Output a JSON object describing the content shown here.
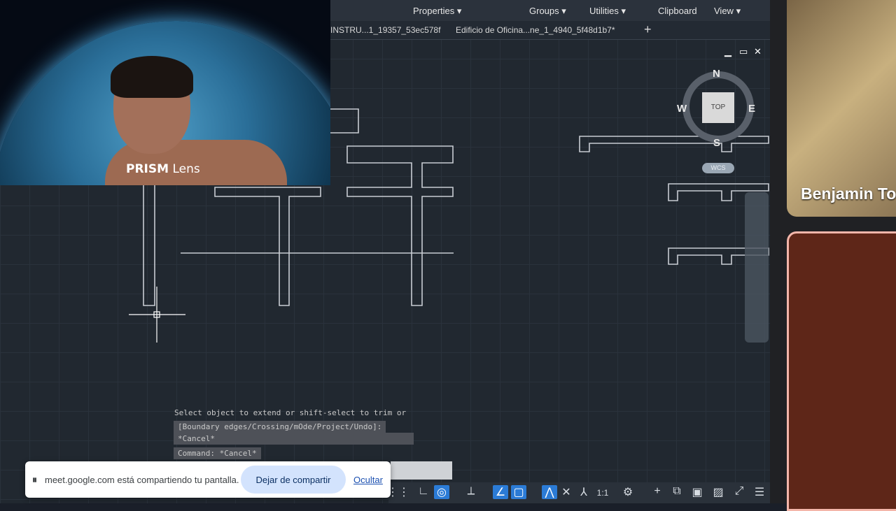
{
  "ribbon": {
    "groups": [
      "Properties",
      "Groups",
      "Utilities",
      "Clipboard",
      "View"
    ]
  },
  "tabs": {
    "file1": "INSTRU...1_19357_53ec578f",
    "file2": "Edificio de Oficina...ne_1_4940_5f48d1b7*",
    "add": "+"
  },
  "viewport_controls": {
    "minimize": "▁",
    "restore": "▭",
    "close": "✕"
  },
  "navcube": {
    "north": "N",
    "south": "S",
    "east": "E",
    "west": "W",
    "face": "TOP",
    "wcs": "WCS"
  },
  "webcam": {
    "brand": "PRISM",
    "brand_suffix": " Lens"
  },
  "command_line": {
    "line1": "Select object to extend or shift-select to trim or",
    "line2": "[Boundary edges/Crossing/mOde/Project/Undo]:",
    "line3": "*Cancel*",
    "line4": "Command: *Cancel*"
  },
  "status_bar": {
    "scale": "1:1",
    "icons": [
      "grid-icon",
      "snap-icon",
      "ortho-icon",
      "polar-icon",
      "osnap-icon",
      "selection-icon",
      "annotation-icon",
      "gear-icon",
      "plus-icon",
      "isolate-icon",
      "hardware-icon",
      "fullscreen-icon",
      "menu-icon"
    ]
  },
  "share_bar": {
    "message": "meet.google.com está compartiendo tu pantalla.",
    "stop_label": "Dejar de compartir",
    "hide_label": "Ocultar"
  },
  "participants": [
    {
      "name": "Benjamin To"
    }
  ],
  "colors": {
    "accent": "#2b7bd6",
    "cad_background": "#212830",
    "tile_border": "#f4b6aa"
  }
}
